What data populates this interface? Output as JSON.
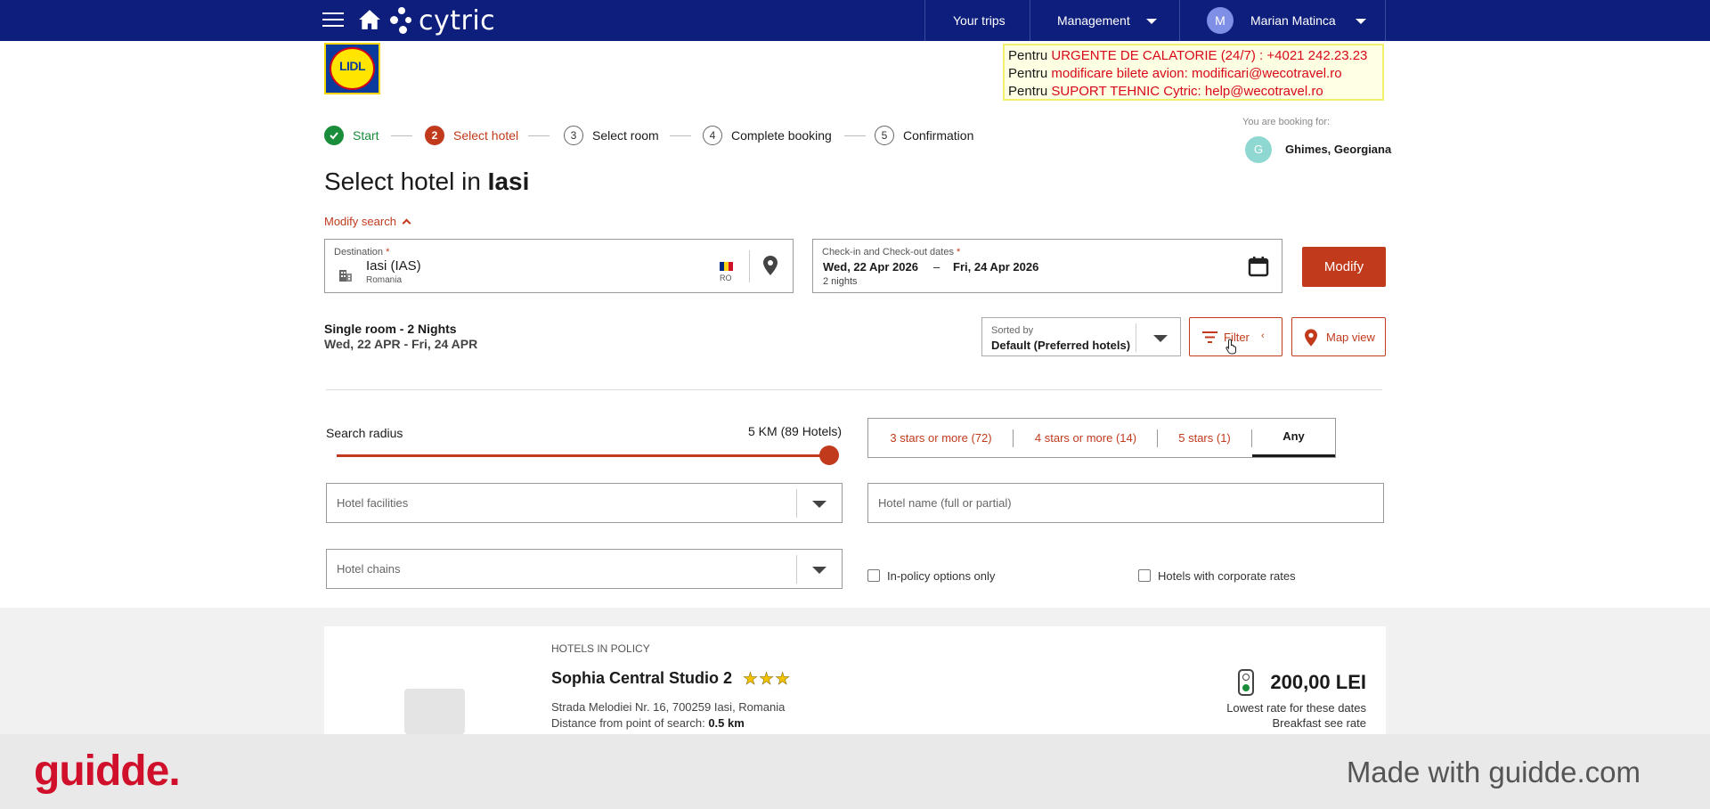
{
  "topbar": {
    "app_name": "cytric",
    "your_trips": "Your trips",
    "management": "Management",
    "user_initial": "M",
    "user_name": "Marian Matinca",
    "bg_color": "#0e1e7c"
  },
  "header": {
    "logo_text": "LIDL",
    "urgent_lines": [
      {
        "prefix": "Pentru",
        "text": "URGENTE DE CALATORIE (24/7) : +4021 242.23.23"
      },
      {
        "prefix": "Pentru",
        "text": "modificare bilete avion:  modificari@wecotravel.ro"
      },
      {
        "prefix": "Pentru",
        "text": "SUPORT TEHNIC Cytric:  help@wecotravel.ro"
      }
    ]
  },
  "stepper": {
    "steps": [
      {
        "num": "",
        "label": "Start",
        "state": "done"
      },
      {
        "num": "2",
        "label": "Select hotel",
        "state": "active"
      },
      {
        "num": "3",
        "label": "Select room",
        "state": "todo"
      },
      {
        "num": "4",
        "label": "Complete booking",
        "state": "todo"
      },
      {
        "num": "5",
        "label": "Confirmation",
        "state": "todo"
      }
    ],
    "booking_for_label": "You are booking for:",
    "traveler_initial": "G",
    "traveler_name": "Ghimes, Georgiana"
  },
  "title": {
    "prefix": "Select hotel in",
    "city": "Iasi"
  },
  "modify_search": "Modify search",
  "search": {
    "destination_label": "Destination",
    "destination_value": "Iasi (IAS)",
    "destination_country": "Romania",
    "country_code": "RO",
    "dates_label": "Check-in and Check-out dates",
    "checkin": "Wed, 22 Apr 2026",
    "date_dash": "–",
    "checkout": "Fri, 24 Apr 2026",
    "nights": "2 nights",
    "required_mark": "*",
    "modify_button": "Modify"
  },
  "summary": {
    "line1": "Single room - 2 Nights",
    "line2": "Wed, 22 APR - Fri, 24 APR"
  },
  "sort": {
    "label": "Sorted by",
    "value": "Default (Preferred hotels)"
  },
  "filter_button": "Filter",
  "map_button": "Map view",
  "filters": {
    "radius_label": "Search radius",
    "radius_value": "5 KM (89 Hotels)",
    "radius_level": 1.0,
    "star_options": [
      {
        "label": "3 stars or more (72)",
        "selected": false
      },
      {
        "label": "4 stars or more (14)",
        "selected": false
      },
      {
        "label": "5 stars (1)",
        "selected": false
      },
      {
        "label": "Any",
        "selected": true
      }
    ],
    "facilities_placeholder": "Hotel facilities",
    "hotel_name_placeholder": "Hotel name (full or partial)",
    "chains_placeholder": "Hotel chains",
    "in_policy_label": "In-policy options only",
    "corporate_label": "Hotels with corporate rates"
  },
  "results": {
    "section_label": "HOTELS IN POLICY",
    "hotel": {
      "name": "Sophia Central Studio 2",
      "stars": 3,
      "address": "Strada Melodiei Nr. 16, 700259 Iasi, Romania",
      "distance_label": "Distance from point of search:",
      "distance_value": "0.5 km",
      "price": "200,00 LEI",
      "rate_note": "Lowest rate for these dates",
      "breakfast_note": "Breakfast see rate"
    }
  },
  "footer": {
    "brand": "guidde.",
    "made_with": "Made with guidde.com"
  },
  "colors": {
    "accent": "#c13a1c",
    "done": "#1a8d3b"
  }
}
